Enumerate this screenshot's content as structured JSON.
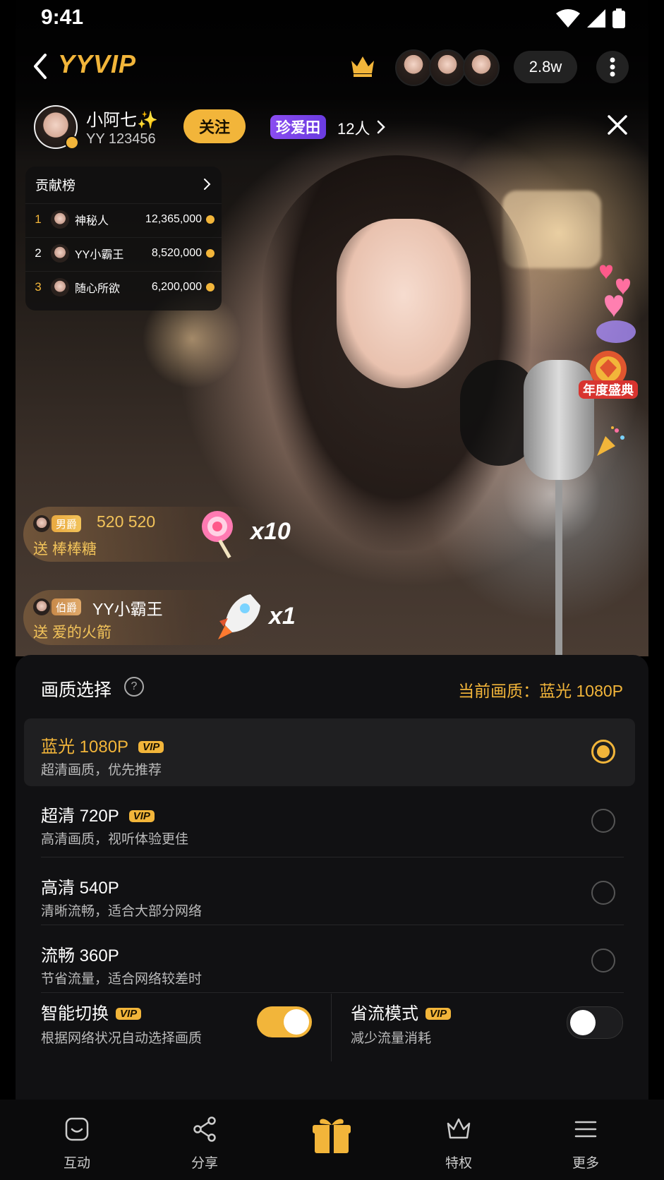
{
  "status": {
    "time": "9:41"
  },
  "header": {
    "brand": "YYVIP",
    "viewer_count": "2.8w"
  },
  "host": {
    "name": "小阿七✨",
    "id": "YY 123456",
    "follow_label": "关注",
    "fan_club": "珍爱田",
    "fan_count": "12人"
  },
  "board": {
    "title": "贡献榜",
    "rows": [
      {
        "rank": "1",
        "name": "神秘人",
        "amount": "12,365,000"
      },
      {
        "rank": "2",
        "name": "YY小霸王",
        "amount": "8,520,000"
      },
      {
        "rank": "3",
        "name": "随心所欲",
        "amount": "6,200,000"
      }
    ]
  },
  "promo": {
    "label": "年度盛典"
  },
  "gifts": [
    {
      "tag": "男爵",
      "name": "520  520",
      "send": "送 棒棒糖",
      "mult": "x10"
    },
    {
      "tag": "伯爵",
      "name": "YY小霸王",
      "send": "送 爱的火箭",
      "mult": "x1"
    }
  ],
  "sheet": {
    "title": "画质选择",
    "current": "当前画质：蓝光 1080P",
    "vip_label": "VIP",
    "options": [
      {
        "label": "蓝光 1080P",
        "desc": "超清画质，优先推荐",
        "vip": true,
        "selected": true
      },
      {
        "label": "超清 720P",
        "desc": "高清画质，视听体验更佳",
        "vip": true,
        "selected": false
      },
      {
        "label": "高清 540P",
        "desc": "清晰流畅，适合大部分网络",
        "vip": false,
        "selected": false
      },
      {
        "label": "流畅 360P",
        "desc": "节省流量，适合网络较差时",
        "vip": false,
        "selected": false
      }
    ],
    "smart_switch": {
      "title": "智能切换",
      "desc": "根据网络状况自动选择画质",
      "on": true
    },
    "data_saver": {
      "title": "省流模式",
      "desc": "减少流量消耗",
      "on": false
    }
  },
  "nav": {
    "interact": "互动",
    "share": "分享",
    "privilege": "特权",
    "more": "更多"
  },
  "colors": {
    "accent": "#f2b53a",
    "purple": "#7a45e8",
    "sheet_bg": "#111113"
  }
}
